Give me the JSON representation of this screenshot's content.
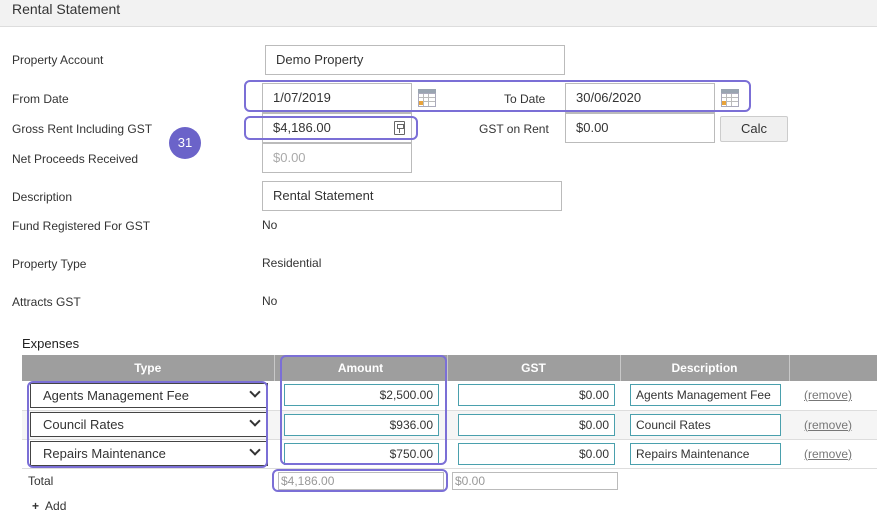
{
  "title": "Rental Statement",
  "form": {
    "property_account_label": "Property Account",
    "property_account_value": "Demo Property",
    "from_date_label": "From Date",
    "from_date_value": "1/07/2019",
    "to_date_label": "To Date",
    "to_date_value": "30/06/2020",
    "gross_rent_label": "Gross Rent Including GST",
    "gross_rent_value": "$4,186.00",
    "gst_on_rent_label": "GST on Rent",
    "gst_on_rent_value": "$0.00",
    "calc_label": "Calc",
    "net_proceeds_label": "Net Proceeds Received",
    "net_proceeds_value": "$0.00",
    "description_label": "Description",
    "description_value": "Rental Statement",
    "fund_gst_label": "Fund Registered For GST",
    "fund_gst_value": "No",
    "property_type_label": "Property Type",
    "property_type_value": "Residential",
    "attracts_gst_label": "Attracts GST",
    "attracts_gst_value": "No"
  },
  "step_badge": "31",
  "expenses": {
    "heading": "Expenses",
    "columns": [
      "Type",
      "Amount",
      "GST",
      "Description",
      ""
    ],
    "rows": [
      {
        "type": "Agents Management Fee",
        "amount": "$2,500.00",
        "gst": "$0.00",
        "description": "Agents Management Fee",
        "remove": "(remove)"
      },
      {
        "type": "Council Rates",
        "amount": "$936.00",
        "gst": "$0.00",
        "description": "Council Rates",
        "remove": "(remove)"
      },
      {
        "type": "Repairs Maintenance",
        "amount": "$750.00",
        "gst": "$0.00",
        "description": "Repairs Maintenance",
        "remove": "(remove)"
      }
    ],
    "total_label": "Total",
    "total_amount": "$4,186.00",
    "total_gst": "$0.00",
    "add_label": "Add"
  },
  "colors": {
    "highlight": "#7b6fd6",
    "step_badge": "#6b63c9",
    "table_header": "#9e9e9e",
    "field_border": "#4aa0ad"
  }
}
